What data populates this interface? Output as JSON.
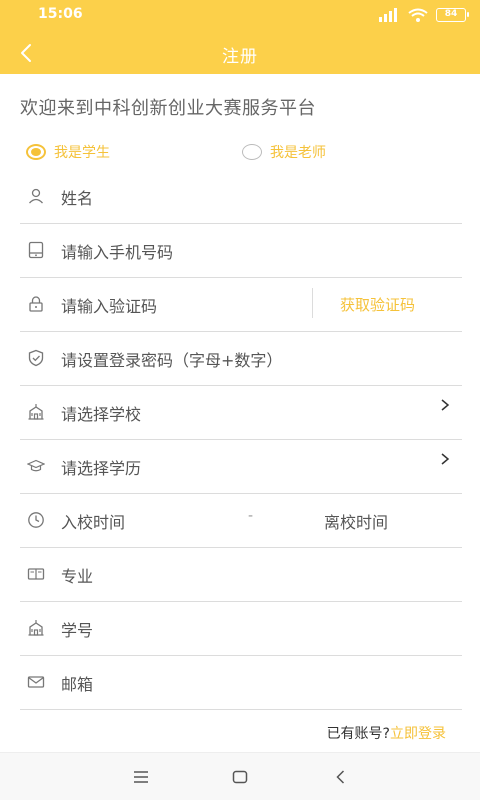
{
  "status": {
    "time": "15:06",
    "battery": "84"
  },
  "header": {
    "title": "注册"
  },
  "welcome": "欢迎来到中科创新创业大赛服务平台",
  "roles": {
    "student": "我是学生",
    "teacher": "我是老师"
  },
  "fields": {
    "name": "姓名",
    "phone": "请输入手机号码",
    "code": "请输入验证码",
    "get_code": "获取验证码",
    "password": "请设置登录密码（字母+数字）",
    "school": "请选择学校",
    "education": "请选择学历",
    "enroll": "入校时间",
    "dash": "-",
    "leave": "离校时间",
    "major": "专业",
    "student_no": "学号",
    "email": "邮箱"
  },
  "login": {
    "prompt": "已有账号?",
    "link": "立即登录"
  },
  "colors": {
    "brand": "#fcd04a",
    "accent": "#f5c23a"
  },
  "icons": {
    "name": "person-icon",
    "phone": "phone-icon",
    "code": "lock-icon",
    "password": "shield-icon",
    "school": "school-icon",
    "education": "graduation-cap-icon",
    "time": "clock-icon",
    "major": "book-icon",
    "student_no": "school-icon",
    "email": "mail-icon"
  }
}
